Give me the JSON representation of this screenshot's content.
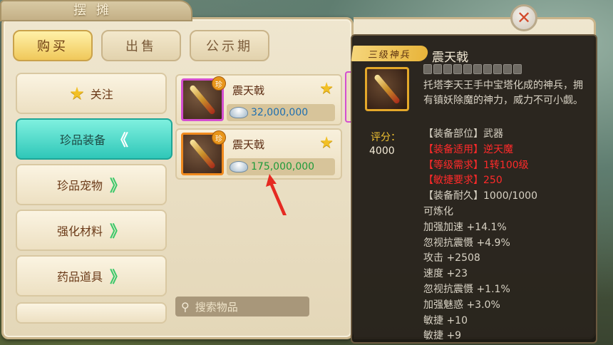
{
  "window": {
    "title": "摆摊",
    "close_glyph": "✕"
  },
  "tabs": [
    {
      "label": "购买",
      "active": true
    },
    {
      "label": "出售",
      "active": false
    },
    {
      "label": "公示期",
      "active": false
    }
  ],
  "sidebar": {
    "items": [
      {
        "label": "关注",
        "icon": "star-icon"
      },
      {
        "label": "珍品装备",
        "active": true,
        "chevron": "《"
      },
      {
        "label": "珍品宠物",
        "chevron": "》"
      },
      {
        "label": "强化材料",
        "chevron": "》"
      },
      {
        "label": "药品道具",
        "chevron": "》"
      }
    ]
  },
  "listings": [
    {
      "name": "震天戟",
      "price": "32,000,000",
      "rarity_color": "#d44fd0",
      "badge": "珍"
    },
    {
      "name": "震天戟",
      "price": "175,000,000",
      "rarity_color": "#f08a1e",
      "badge": "珍"
    }
  ],
  "search": {
    "placeholder": "搜索物品"
  },
  "tooltip": {
    "tier": "三级神兵",
    "name": "震天戟",
    "description": "托塔李天王手中宝塔化成的神兵，拥有镇妖除魔的神力，威力不可小觑。",
    "score_label": "评分：",
    "score_value": "4000",
    "stats": [
      {
        "text": "【装备部位】武器",
        "color": "normal"
      },
      {
        "text": "【装备适用】逆天魔",
        "color": "red"
      },
      {
        "text": "【等级需求】1转100级",
        "color": "red"
      },
      {
        "text": "【敏捷要求】250",
        "color": "red"
      },
      {
        "text": "【装备耐久】1000/1000",
        "color": "normal"
      },
      {
        "text": "可炼化",
        "color": "normal"
      },
      {
        "text": "加强加速 +14.1%",
        "color": "normal"
      },
      {
        "text": "忽视抗震慑 +4.9%",
        "color": "normal"
      },
      {
        "text": "攻击 +2508",
        "color": "normal"
      },
      {
        "text": "速度 +23",
        "color": "normal"
      },
      {
        "text": "忽视抗震慑 +1.1%",
        "color": "normal"
      },
      {
        "text": "加强魅惑 +3.0%",
        "color": "normal"
      },
      {
        "text": "敏捷 +10",
        "color": "normal"
      },
      {
        "text": "敏捷 +9",
        "color": "normal"
      }
    ]
  }
}
